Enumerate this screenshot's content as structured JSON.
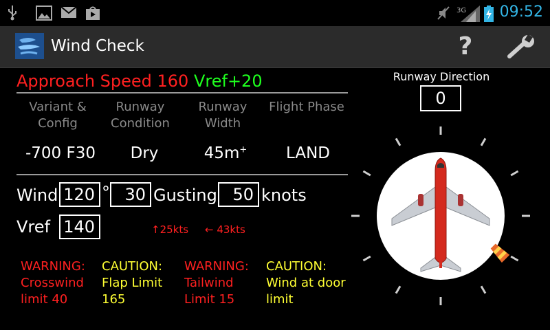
{
  "status_bar": {
    "time": "09:52",
    "icons": [
      "usb-icon",
      "image-icon",
      "mail-icon",
      "store-icon",
      "mute-icon",
      "signal-3g-icon",
      "battery-charging-icon"
    ]
  },
  "action_bar": {
    "title": "Wind Check",
    "help_label": "?",
    "icons": [
      "app-logo-icon",
      "help-icon",
      "wrench-icon"
    ]
  },
  "approach": {
    "speed_text": "Approach Speed 160",
    "vref_add": "Vref+20"
  },
  "columns": [
    {
      "header": "Variant &\nConfig",
      "value": "-700 F30"
    },
    {
      "header": "Runway\nCondition",
      "value": "Dry"
    },
    {
      "header": "Runway\nWidth",
      "value": "45m",
      "suffix": "+"
    },
    {
      "header": "Flight Phase",
      "value": "LAND"
    }
  ],
  "wind": {
    "label": "Wind",
    "direction": "120",
    "degree_symbol": "°",
    "speed": "30",
    "gusting_label": "Gusting",
    "gust": "50",
    "units": "knots"
  },
  "vref": {
    "label": "Vref",
    "value": "140",
    "headwind": "↑25kts",
    "crosswind": "← 43kts"
  },
  "warnings": [
    {
      "type": "WARNING:",
      "text": "Crosswind\nlimit 40",
      "color": "#ff2020"
    },
    {
      "type": "CAUTION:",
      "text": "Flap Limit\n165",
      "color": "#ffff33"
    },
    {
      "type": "WARNING:",
      "text": "Tailwind\nLimit 15",
      "color": "#ff2020"
    },
    {
      "type": "CAUTION:",
      "text": "Wind at door\nlimit",
      "color": "#ffff33"
    }
  ],
  "runway": {
    "title": "Runway Direction",
    "value": "0"
  },
  "compass": {
    "wind_direction_deg": 120,
    "aircraft_color": "#d42a1e"
  }
}
